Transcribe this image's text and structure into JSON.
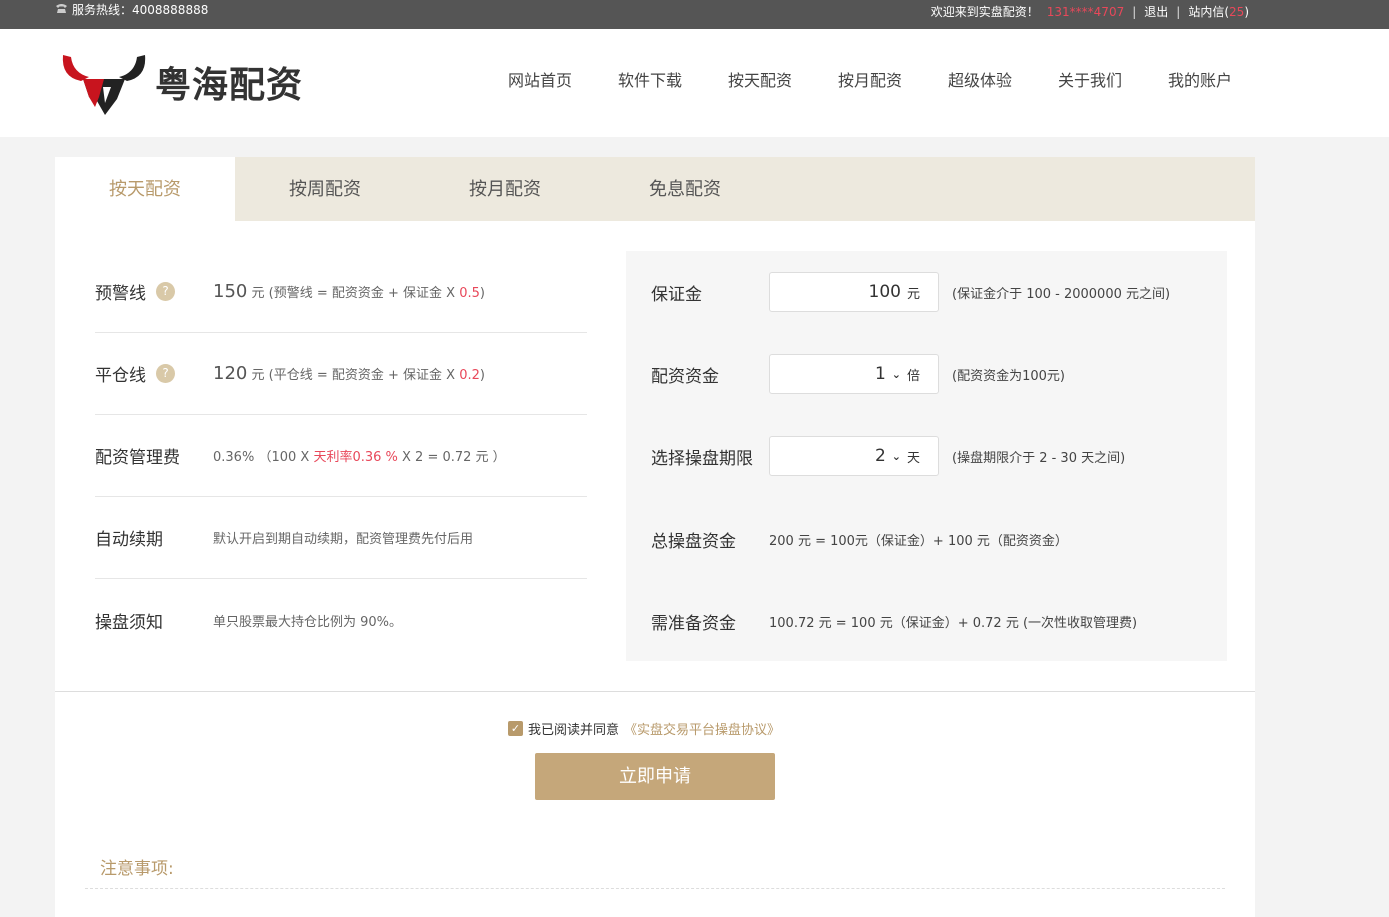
{
  "topbar": {
    "hotline": "服务热线：4008888888",
    "welcome": "欢迎来到实盘配资！",
    "user": "131****4707",
    "logout": "退出",
    "messages_label": "站内信",
    "messages_count": "25",
    "accent": "#e8485a"
  },
  "header": {
    "logo_text": "粤海配资",
    "nav": [
      "网站首页",
      "软件下载",
      "按天配资",
      "按月配资",
      "超级体验",
      "关于我们",
      "我的账户"
    ]
  },
  "tabs": [
    "按天配资",
    "按周配资",
    "按月配资",
    "免息配资"
  ],
  "left": {
    "warning": {
      "label": "预警线",
      "value": "150",
      "unit": "元",
      "formula": "(预警线 = 配资资金 + 保证金 X ",
      "ratio": "0.5",
      "close": ")"
    },
    "liquidation": {
      "label": "平仓线",
      "value": "120",
      "unit": "元",
      "formula": "(平仓线 = 配资资金 + 保证金 X ",
      "ratio": "0.2",
      "close": ")"
    },
    "fee": {
      "label": "配资管理费",
      "value": "0.36%",
      "formula_a": "（100 X ",
      "rate": "天利率0.36 %",
      "formula_b": " X 2 = 0.72 元 ）"
    },
    "renew": {
      "label": "自动续期",
      "text": "默认开启到期自动续期，配资管理费先付后用"
    },
    "notice": {
      "label": "操盘须知",
      "text": "单只股票最大持仓比例为 90%。"
    }
  },
  "right": {
    "deposit": {
      "label": "保证金",
      "value": "100",
      "unit": "元",
      "hint": "(保证金介于 100 - 2000000 元之间)"
    },
    "multiple": {
      "label": "配资资金",
      "value": "1",
      "unit": "倍",
      "hint": "(配资资金为100元)"
    },
    "period": {
      "label": "选择操盘期限",
      "value": "2",
      "unit": "天",
      "hint": "(操盘期限介于 2 - 30 天之间)"
    },
    "total": {
      "label": "总操盘资金",
      "text": "200 元 = 100元（保证金）+ 100 元（配资资金）"
    },
    "required": {
      "label": "需准备资金",
      "text": "100.72 元 = 100 元（保证金）+ 0.72 元 (一次性收取管理费)"
    }
  },
  "agreement": {
    "text": "我已阅读并同意",
    "link": "《实盘交易平台操盘协议》"
  },
  "apply_button": "立即申请",
  "notes_title": "注意事项:",
  "colors": {
    "gold": "#b89a6b",
    "button": "#c5a77a",
    "tabbar": "#ede9de"
  }
}
